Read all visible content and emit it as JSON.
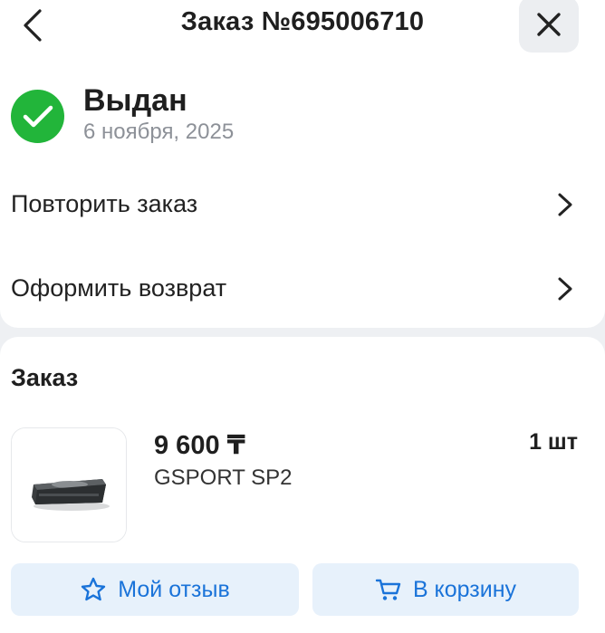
{
  "header": {
    "title": "Заказ №695006710",
    "back_icon": "chevron-left-icon",
    "close_icon": "close-icon"
  },
  "status": {
    "title": "Выдан",
    "date": "6 ноября, 2025",
    "icon": "check-circle-icon",
    "color": "#22b53a"
  },
  "actions": [
    {
      "label": "Повторить заказ",
      "icon": "chevron-right-icon"
    },
    {
      "label": "Оформить возврат",
      "icon": "chevron-right-icon"
    }
  ],
  "order": {
    "section_title": "Заказ",
    "item": {
      "price": "9 600 ₸",
      "name": "GSPORT SP2",
      "quantity": "1 шт"
    },
    "buttons": {
      "review_label": "Мой отзыв",
      "review_icon": "star-icon",
      "cart_label": "В корзину",
      "cart_icon": "cart-icon"
    }
  },
  "colors": {
    "accent": "#1a73d9",
    "button_bg": "#e7f1fb",
    "page_bg": "#eef0f3"
  }
}
